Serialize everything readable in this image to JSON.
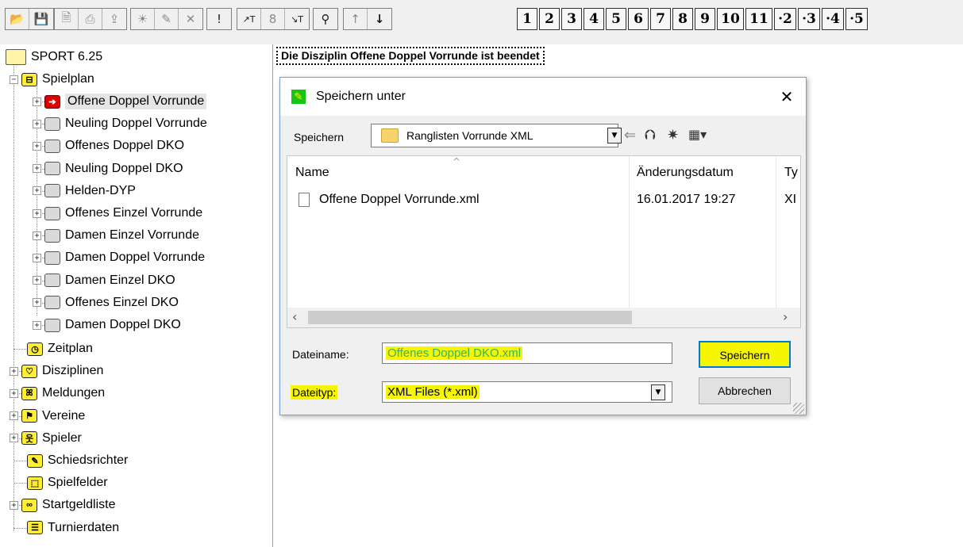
{
  "toolbar": {
    "groups": [
      {
        "icons": [
          "open-folder-icon",
          "save-disk-icon"
        ]
      },
      {
        "icons": [
          "preview-icon",
          "print-icon",
          "export-icon"
        ]
      },
      {
        "icons": [
          "sun-icon",
          "pencil-icon",
          "cross-icon"
        ]
      },
      {
        "icons": [
          "exclamation-icon"
        ]
      },
      {
        "icons": [
          "table-up-icon",
          "eight-icon",
          "table-down-icon"
        ]
      },
      {
        "icons": [
          "magnifier-icon"
        ]
      },
      {
        "icons": [
          "arrow-up-icon",
          "arrow-down-icon"
        ]
      }
    ],
    "numbers": [
      "1",
      "2",
      "3",
      "4",
      "5",
      "6",
      "7",
      "8",
      "9",
      "10",
      "11",
      "·2",
      "·3",
      "·4",
      "·5"
    ]
  },
  "tree": {
    "root": "SPORT 6.25",
    "spielplan": "Spielplan",
    "spielplan_children": [
      "Offene Doppel Vorrunde",
      "Neuling Doppel Vorrunde",
      "Offenes Doppel DKO",
      "Neuling Doppel DKO",
      "Helden-DYP",
      "Offenes Einzel Vorrunde",
      "Damen Einzel Vorrunde",
      "Damen Doppel Vorrunde",
      "Damen Einzel DKO",
      "Offenes Einzel DKO",
      "Damen Doppel DKO"
    ],
    "others": [
      {
        "label": "Zeitplan",
        "icon": "clock-icon",
        "expandable": false
      },
      {
        "label": "Disziplinen",
        "icon": "discipline-icon",
        "expandable": true
      },
      {
        "label": "Meldungen",
        "icon": "registrations-icon",
        "expandable": true
      },
      {
        "label": "Vereine",
        "icon": "flag-icon",
        "expandable": true
      },
      {
        "label": "Spieler",
        "icon": "player-icon",
        "expandable": true
      },
      {
        "label": "Schiedsrichter",
        "icon": "pencil-icon",
        "expandable": false
      },
      {
        "label": "Spielfelder",
        "icon": "field-icon",
        "expandable": false
      },
      {
        "label": "Startgeldliste",
        "icon": "money-icon",
        "expandable": true
      },
      {
        "label": "Turnierdaten",
        "icon": "document-icon",
        "expandable": false
      }
    ]
  },
  "banner": "Die Disziplin Offene Doppel Vorrunde ist beendet",
  "dialog": {
    "title": "Speichern unter",
    "save_in_label": "Speichern",
    "save_in_value": "Ranglisten Vorrunde XML",
    "columns": [
      "Name",
      "Änderungsdatum",
      "Ty"
    ],
    "files": [
      {
        "name": "Offene Doppel Vorrunde.xml",
        "date": "16.01.2017 19:27",
        "type": "XI"
      }
    ],
    "filename_label": "Dateiname:",
    "filename_value": "Offenes Doppel DKO.xml",
    "filetype_label": "Dateityp:",
    "filetype_value": "XML Files (*.xml)",
    "save_button": "Speichern",
    "cancel_button": "Abbrechen"
  },
  "colors": {
    "highlight": "#f6f600",
    "selected_node_icon": "#e00000",
    "accent_border": "#0078d7"
  }
}
